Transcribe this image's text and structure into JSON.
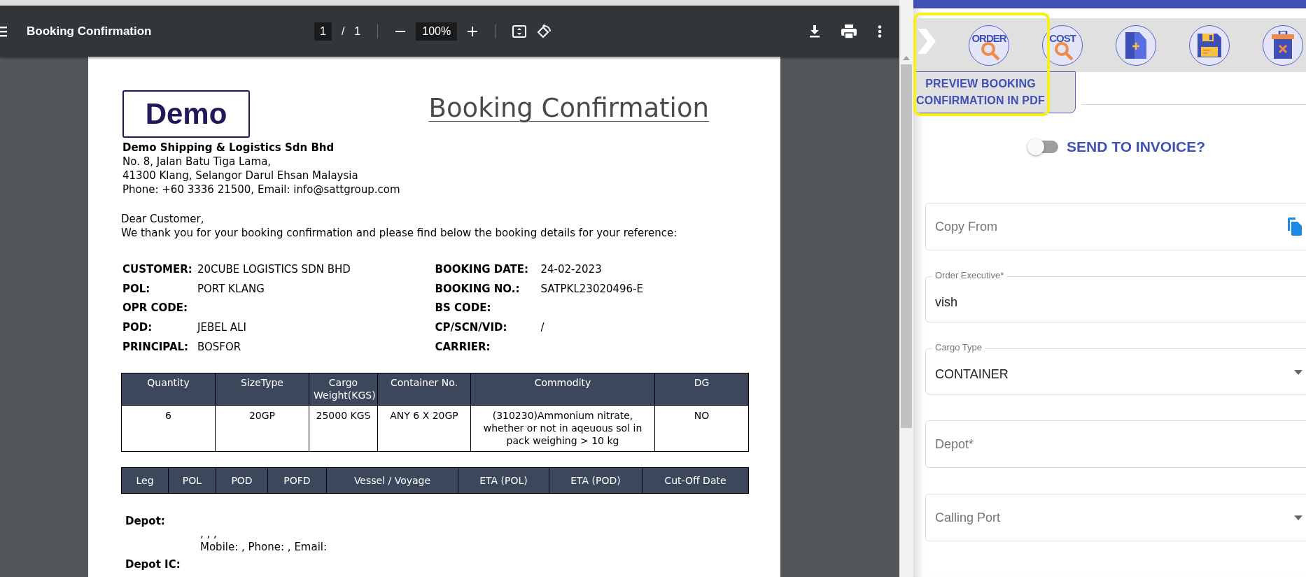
{
  "viewer": {
    "title": "Booking Confirmation",
    "page_current": "1",
    "page_separator": "/",
    "page_total": "1",
    "zoom": "100%"
  },
  "document": {
    "logo": "Demo",
    "title": "Booking Confirmation",
    "company": [
      "Demo Shipping & Logistics Sdn Bhd",
      "No. 8, Jalan Batu Tiga Lama,",
      "41300 Klang, Selangor Darul Ehsan Malaysia",
      "Phone: +60 3336 21500, Email: info@sattgroup.com"
    ],
    "greeting": "Dear Customer,",
    "intro": "We thank you for your booking confirmation and please find below the booking details for your reference:",
    "details_left": [
      {
        "label": "CUSTOMER:",
        "value": "20CUBE LOGISTICS SDN BHD"
      },
      {
        "label": "POL:",
        "value": "PORT KLANG"
      },
      {
        "label": "OPR CODE:"
      },
      {
        "label": "POD:",
        "value": "JEBEL ALI"
      },
      {
        "label": "PRINCIPAL:",
        "value": "BOSFOR"
      }
    ],
    "details_right": [
      {
        "label": "BOOKING DATE:",
        "value": "24-02-2023"
      },
      {
        "label": "BOOKING NO.:",
        "value": "SATPKL23020496-E"
      },
      {
        "label": "BS CODE:"
      },
      {
        "label": "CP/SCN/VID:",
        "value": "/"
      },
      {
        "label": "CARRIER:"
      }
    ],
    "cargo_table": {
      "columns": [
        "Quantity",
        "SizeType",
        "Cargo Weight(KGS)",
        "Container No.",
        "Commodity",
        "DG"
      ],
      "rows": [
        [
          "6",
          "20GP",
          "25000 KGS",
          "ANY 6 X 20GP",
          "(310230)Ammonium nitrate, whether or not in aqeuous sol in pack weighing > 10 kg",
          "NO"
        ]
      ]
    },
    "route_table": {
      "columns": [
        "Leg",
        "POL",
        "POD",
        "POFD",
        "Vessel / Voyage",
        "ETA (POL)",
        "ETA (POD)",
        "Cut-Off Date"
      ]
    },
    "depot_label": "Depot:",
    "depot_lines": [
      ", , ,",
      "Mobile: , Phone: , Email:"
    ],
    "depot_ic_label": "Depot IC:"
  },
  "panel": {
    "toolbar": [
      {
        "kind": "expand"
      },
      {
        "kind": "order-search",
        "label": "ORDER"
      },
      {
        "kind": "cost-search",
        "label": "COST"
      },
      {
        "kind": "new-document"
      },
      {
        "kind": "save"
      },
      {
        "kind": "delete"
      }
    ],
    "tooltip": "PREVIEW BOOKING CONFIRMATION IN PDF",
    "toggle": {
      "label": "SEND TO INVOICE?",
      "on": false
    },
    "fields": [
      {
        "kind": "copy",
        "label": "Copy From"
      },
      {
        "kind": "text",
        "label": "Order Executive*",
        "value": "vish"
      },
      {
        "kind": "select",
        "label": "Cargo Type",
        "value": "CONTAINER"
      },
      {
        "kind": "text",
        "label": "Depot*"
      },
      {
        "kind": "select",
        "label": "Calling Port"
      }
    ]
  }
}
